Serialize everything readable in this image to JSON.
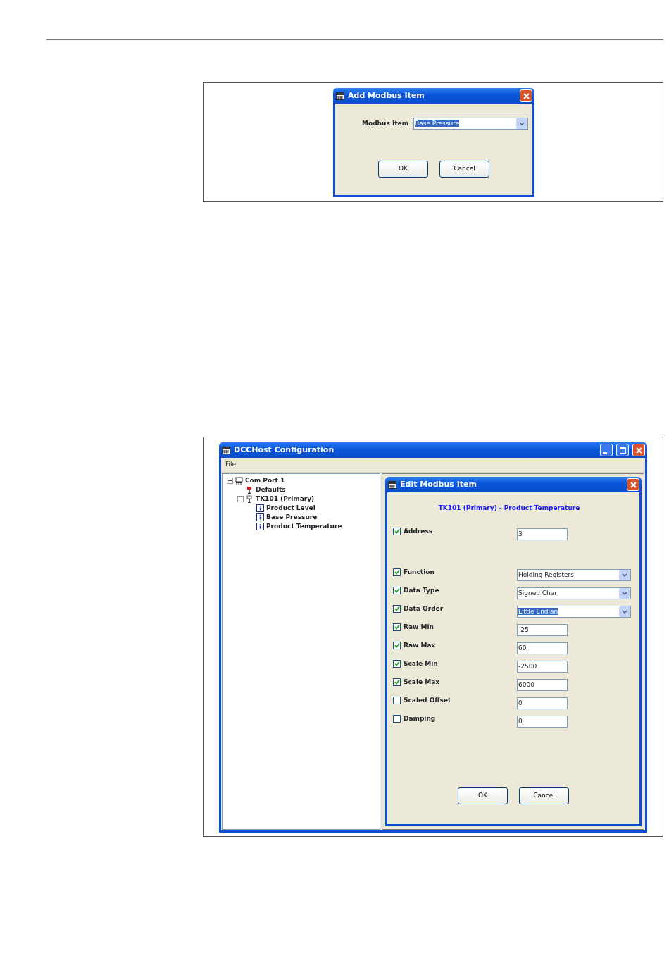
{
  "add_dialog": {
    "title": "Add Modbus Item",
    "field_label": "Modbus Item",
    "field_value": "Base Pressure",
    "field_highlighted": true,
    "buttons": [
      "OK",
      "Cancel"
    ]
  },
  "main_window": {
    "title": "DCCHost Configuration",
    "menu": [
      "File"
    ],
    "tree": [
      {
        "label": "Com Port 1",
        "kind": "port",
        "expanded": true,
        "children": [
          {
            "label": "Defaults",
            "kind": "defaults"
          },
          {
            "label": "TK101 (Primary)",
            "kind": "tank",
            "expanded": true,
            "children": [
              {
                "label": "Product Level",
                "kind": "item"
              },
              {
                "label": "Base Pressure",
                "kind": "item"
              },
              {
                "label": "Product Temperature",
                "kind": "item"
              }
            ]
          }
        ]
      }
    ],
    "edit_dialog": {
      "title": "Edit Modbus Item",
      "heading": "TK101 (Primary) - Product Temperature",
      "field_groups": [
        [
          {
            "label": "Address",
            "checked": true,
            "kind": "text",
            "value": "3"
          }
        ],
        [
          {
            "label": "Function",
            "checked": true,
            "kind": "select",
            "value": "Holding Registers"
          },
          {
            "label": "Data Type",
            "checked": true,
            "kind": "select",
            "value": "Signed Char"
          },
          {
            "label": "Data Order",
            "checked": true,
            "kind": "select",
            "value": "Little Endian",
            "highlighted": true
          },
          {
            "label": "Raw Min",
            "checked": true,
            "kind": "text",
            "value": "-25"
          },
          {
            "label": "Raw Max",
            "checked": true,
            "kind": "text",
            "value": "60"
          },
          {
            "label": "Scale Min",
            "checked": true,
            "kind": "text",
            "value": "-2500"
          },
          {
            "label": "Scale Max",
            "checked": true,
            "kind": "text",
            "value": "6000"
          },
          {
            "label": "Scaled Offset",
            "checked": false,
            "kind": "text",
            "value": "0"
          },
          {
            "label": "Damping",
            "checked": false,
            "kind": "text",
            "value": "0"
          }
        ]
      ],
      "buttons": [
        "OK",
        "Cancel"
      ]
    }
  }
}
